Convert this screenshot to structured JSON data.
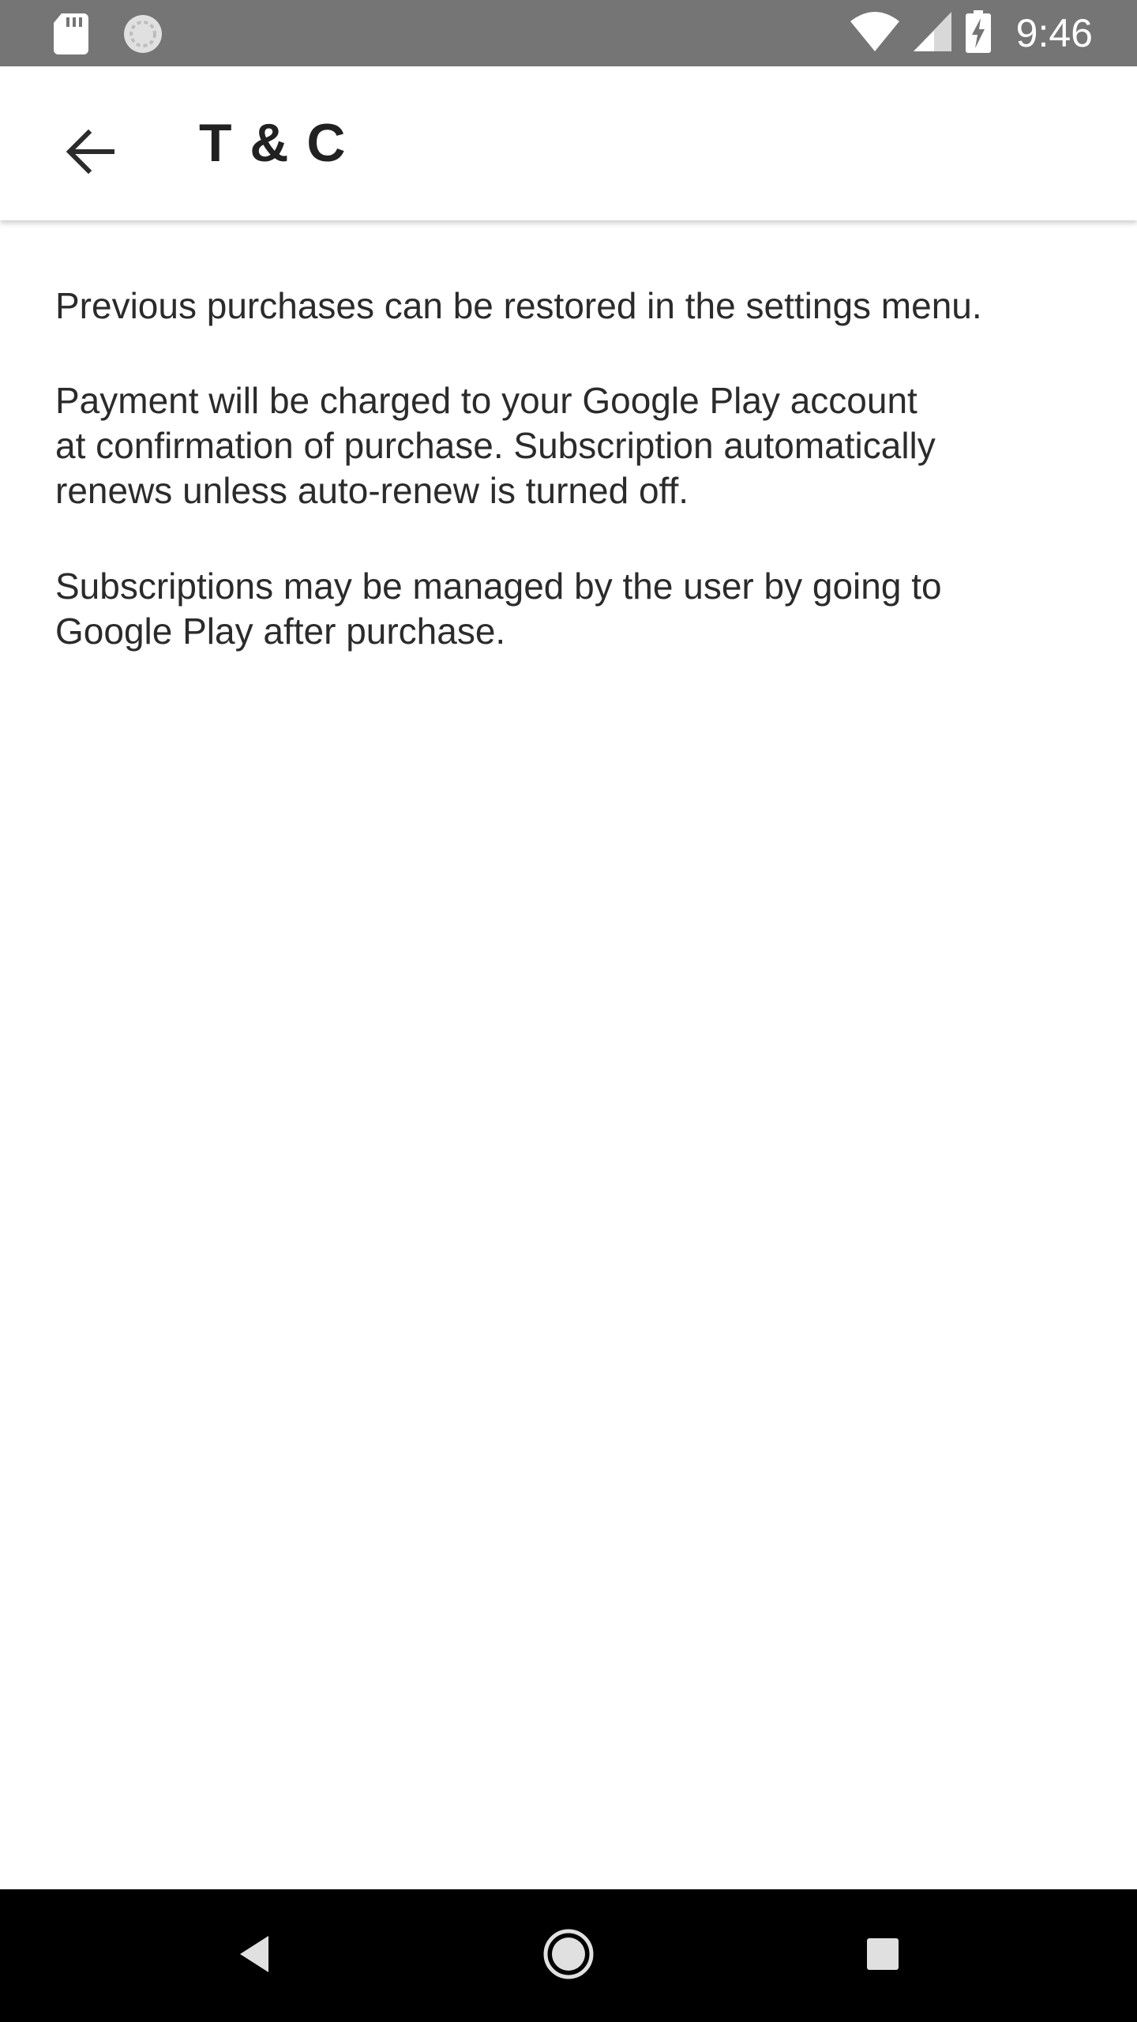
{
  "status_bar": {
    "time": "9:46",
    "icons": [
      "sd-card-icon",
      "sync-icon",
      "wifi-icon",
      "signal-icon",
      "battery-charging-icon"
    ]
  },
  "app_bar": {
    "title": "T & C",
    "back_icon": "arrow-back-icon"
  },
  "content": {
    "paragraphs": [
      "Previous purchases can be restored in the settings menu.",
      "Payment will be charged to your Google Play account\nat confirmation of purchase. Subscription automatically\nrenews unless auto-renew is turned off.",
      "Subscriptions may be managed by the user by going to\nGoogle Play after purchase."
    ]
  },
  "nav_bar": {
    "icons": [
      "nav-back-icon",
      "nav-home-icon",
      "nav-recents-icon"
    ]
  },
  "colors": {
    "status_bar": "#757575",
    "text": "#2b2b2b",
    "title": "#212121",
    "nav_bar": "#000000"
  }
}
